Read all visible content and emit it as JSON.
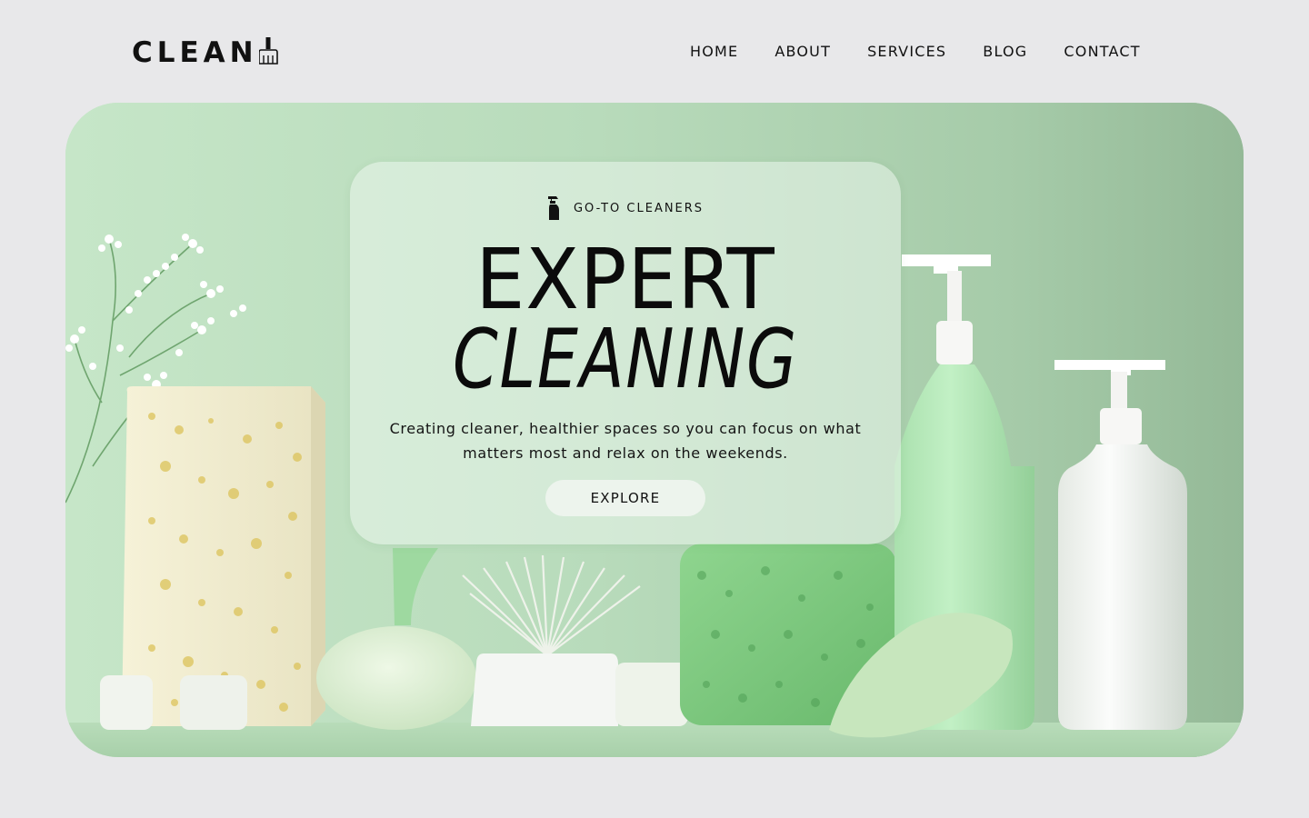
{
  "brand": {
    "logo_text": "CLEAN",
    "logo_icon": "broom-icon"
  },
  "nav": {
    "items": [
      {
        "label": "HOME"
      },
      {
        "label": "ABOUT"
      },
      {
        "label": "SERVICES"
      },
      {
        "label": "BLOG"
      },
      {
        "label": "CONTACT"
      }
    ]
  },
  "hero": {
    "kicker_icon": "spray-bottle-icon",
    "kicker": "GO-TO CLEANERS",
    "title_line1": "EXPERT",
    "title_line2": "CLEANING",
    "description": "Creating cleaner, healthier spaces so you can focus on what matters most and relax on the weekends.",
    "cta_label": "EXPLORE",
    "image_alt_subjects": [
      "baby's breath flowers",
      "yellow-white sponge block",
      "round green sponge",
      "scrub brush",
      "green scrubbing sponge",
      "green pump bottle",
      "white pump bottle"
    ]
  },
  "colors": {
    "page_bg": "#e8e8ea",
    "hero_green": "#b9dcbc",
    "card_glass": "#e3f1e4",
    "text": "#111111",
    "button_bg": "#edf4ed"
  }
}
